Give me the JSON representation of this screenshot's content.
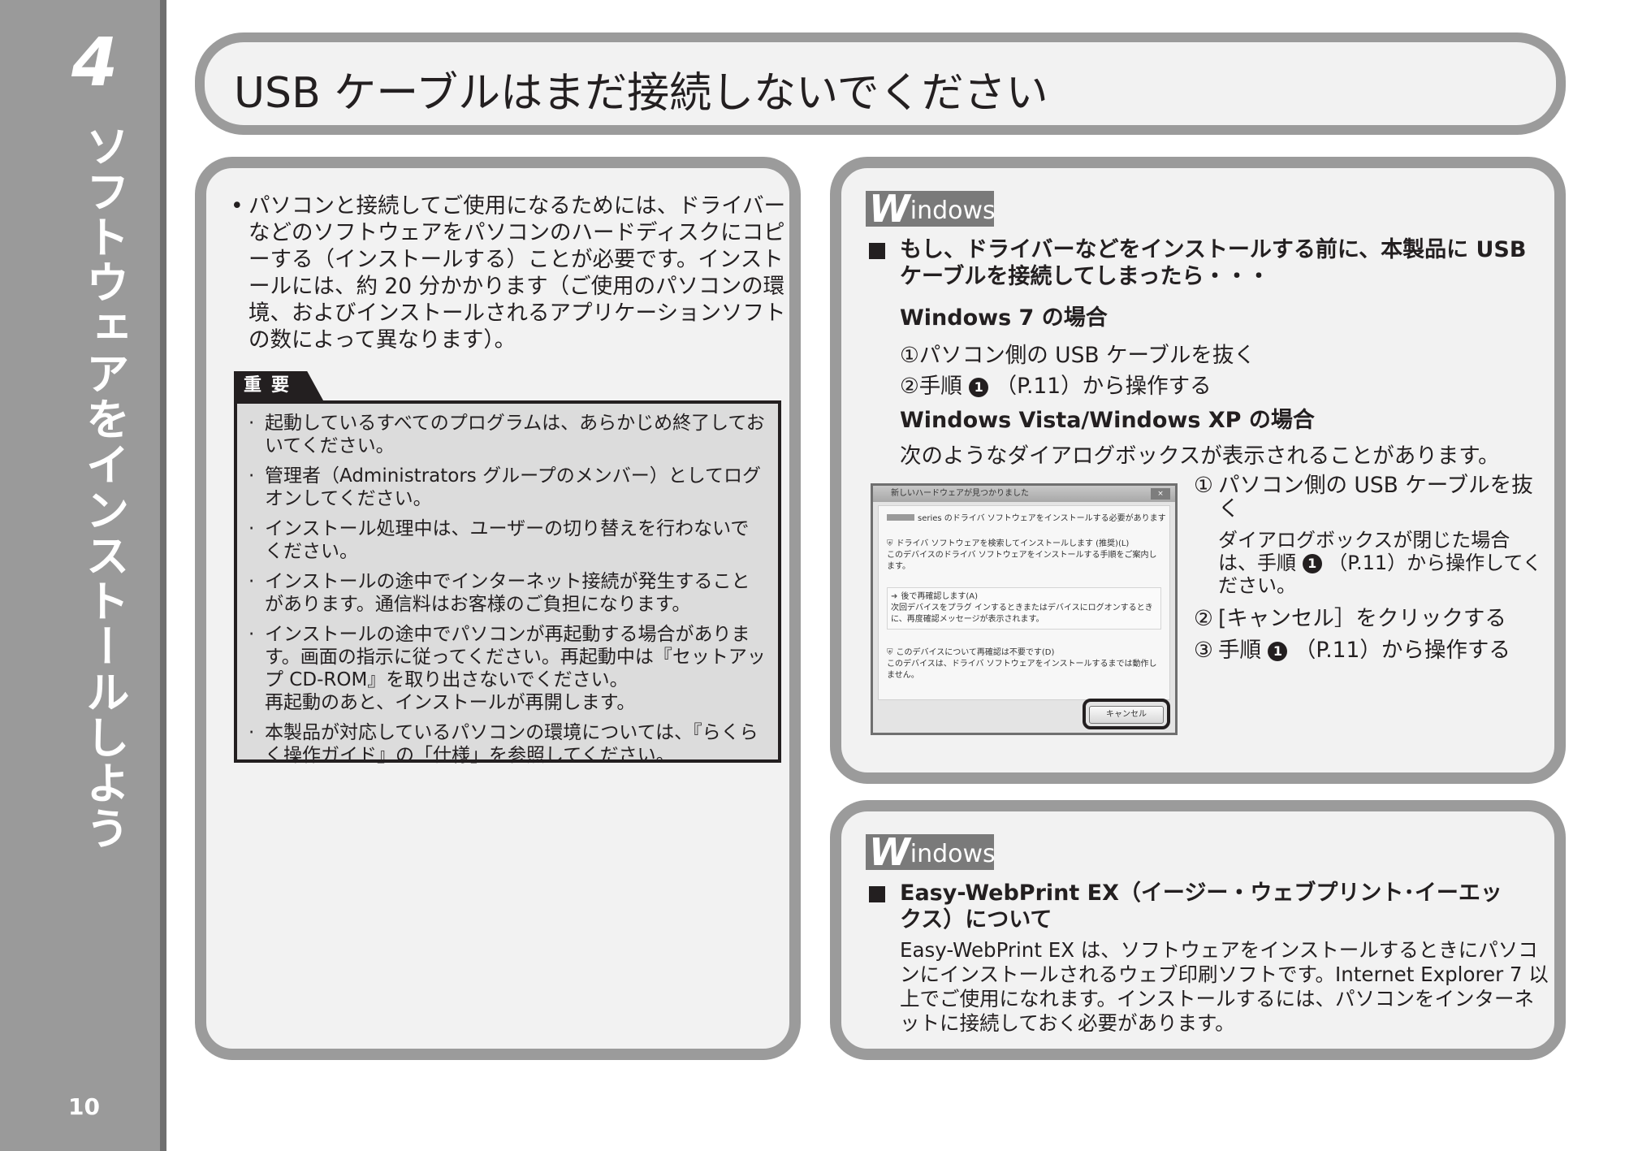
{
  "side_tab": {
    "chapter_number": "4",
    "chapter_title": "ソフトウェアをインストールしよう",
    "page_number": "10"
  },
  "page_title": "USB ケーブルはまだ接続しないでください",
  "left": {
    "intro_bullet": "•",
    "intro_text": "パソコンと接続してご使用になるためには、ドライバーなどのソフトウェアをパソコンのハードディスクにコピーする（インストールする）ことが必要です。インストールには、約 20 分かかります（ご使用のパソコンの環境、およびインストールされるアプリケーションソフトの数によって異なります）。",
    "important_label": "重要",
    "important_items": [
      {
        "text": "起動しているすべてのプログラムは、あらかじめ終了しておいてください。",
        "extra": ""
      },
      {
        "text": "管理者（Administrators グループのメンバー）としてログオンしてください。",
        "extra": ""
      },
      {
        "text": "インストール処理中は、ユーザーの切り替えを行わないでください。",
        "extra": ""
      },
      {
        "text": "インストールの途中でインターネット接続が発生することがあります。通信料はお客様のご負担になります。",
        "extra": ""
      },
      {
        "text": "インストールの途中でパソコンが再起動する場合があります。画面の指示に従ってください。再起動中は『セットアップ CD-ROM』を取り出さないでください。",
        "extra": "再起動のあと、インストールが再開します。"
      },
      {
        "text": "本製品が対応しているパソコンの環境については、『らくらく操作ガイド』の「仕様」を参照してください。",
        "extra": ""
      }
    ]
  },
  "windows_box_1": {
    "logo_w": "W",
    "logo_rest": "indows",
    "heading": "もし、ドライバーなどをインストールする前に、本製品に USB ケーブルを接続してしまったら・・・",
    "win7_heading": "Windows 7 の場合",
    "win7_step1": "①パソコン側の USB ケーブルを抜く",
    "win7_step2_prefix": "②手順",
    "step_icon": "1",
    "win7_step2_suffix": "（P.11）から操作する",
    "vista_heading": "Windows Vista/Windows XP の場合",
    "vista_text": "次のようなダイアログボックスが表示されることがあります。",
    "dialog": {
      "title": "新しいハードウェアが見つかりました",
      "close": "×",
      "heading": "series のドライバ ソフトウェアをインストールする必要があります",
      "option1_title": "ドライバ ソフトウェアを検索してインストールします (推奨)(L)",
      "option1_desc": "このデバイスのドライバ ソフトウェアをインストールする手順をご案内します。",
      "option2_title": "後で再確認します(A)",
      "option2_desc": "次回デバイスをプラグ インするときまたはデバイスにログオンするときに、再度確認メッセージが表示されます。",
      "option3_title": "このデバイスについて再確認は不要です(D)",
      "option3_desc": "このデバイスは、ドライバ ソフトウェアをインストールするまでは動作しません。",
      "cancel": "キャンセル"
    },
    "vista_steps": [
      {
        "num": "①",
        "text": "パソコン側の USB ケーブルを抜く"
      },
      {
        "num": "②",
        "text": "[キャンセル］をクリックする"
      },
      {
        "num": "③",
        "text_prefix": "手順",
        "text_suffix": "（P.11）から操作する"
      }
    ],
    "vista_note_prefix": "ダイアログボックスが閉じた場合は、手順",
    "vista_note_suffix": "（P.11）から操作してください。"
  },
  "windows_box_2": {
    "logo_w": "W",
    "logo_rest": "indows",
    "heading": "Easy-WebPrint EX（イージー・ウェブプリント･イーエックス）について",
    "body": "Easy-WebPrint EX は、ソフトウェアをインストールするときにパソコンにインストールされるウェブ印刷ソフトです。Internet Explorer 7 以上でご使用になれます。インストールするには、パソコンをインターネットに接続しておく必要があります。"
  }
}
